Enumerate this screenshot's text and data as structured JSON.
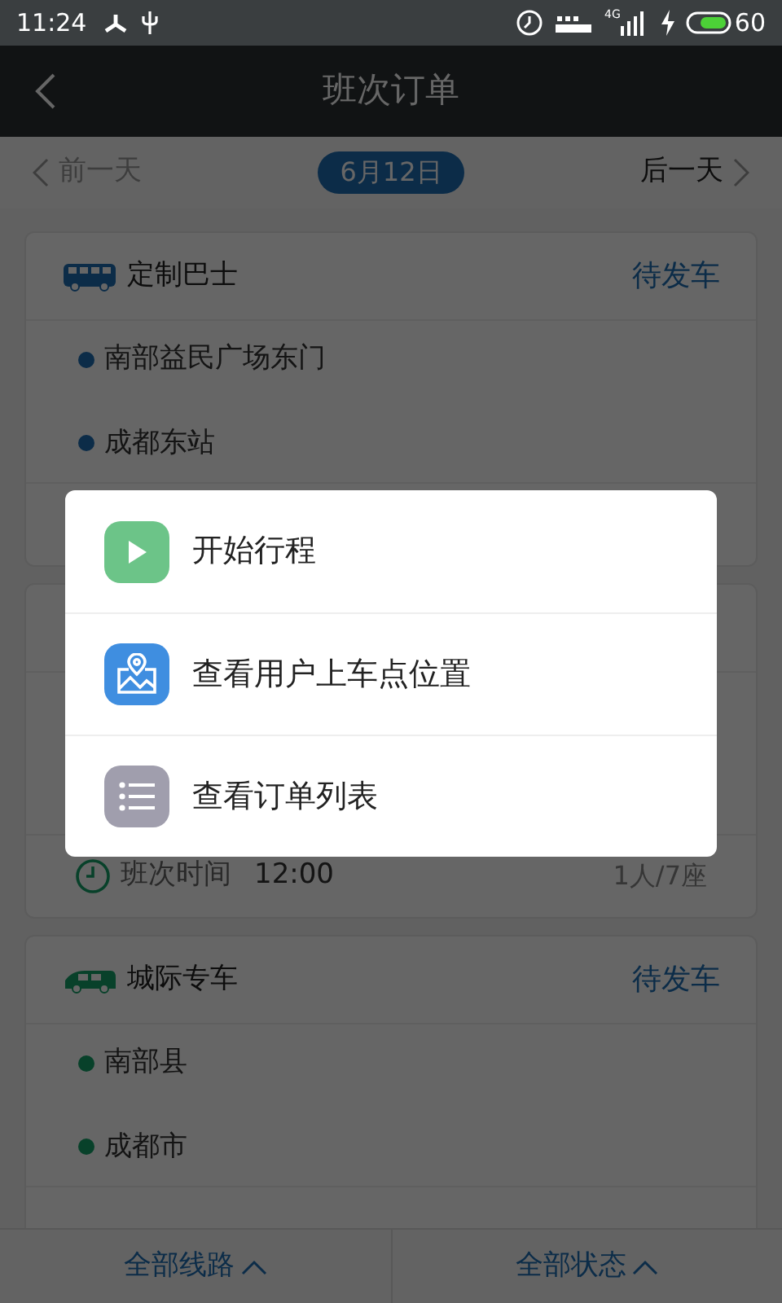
{
  "status_bar": {
    "time": "11:24",
    "network": "4G",
    "battery": "60"
  },
  "header": {
    "title": "班次订单"
  },
  "date_bar": {
    "prev": "前一天",
    "date": "6月12日",
    "next": "后一天"
  },
  "trips": [
    {
      "kind": "bus",
      "type": "定制巴士",
      "status": "待发车",
      "stops": [
        "南部益民广场东门",
        "成都东站"
      ]
    },
    {
      "kind": "hidden",
      "time_label": "班次时间",
      "time": "12:00",
      "seats": "1人/7座"
    },
    {
      "kind": "car",
      "type": "城际专车",
      "status": "待发车",
      "stops": [
        "南部县",
        "成都市"
      ]
    }
  ],
  "filters": [
    {
      "label": "全部线路"
    },
    {
      "label": "全部状态"
    }
  ],
  "menu": [
    {
      "kind": "play",
      "label": "开始行程"
    },
    {
      "kind": "map",
      "label": "查看用户上车点位置"
    },
    {
      "kind": "list",
      "label": "查看订单列表"
    }
  ]
}
